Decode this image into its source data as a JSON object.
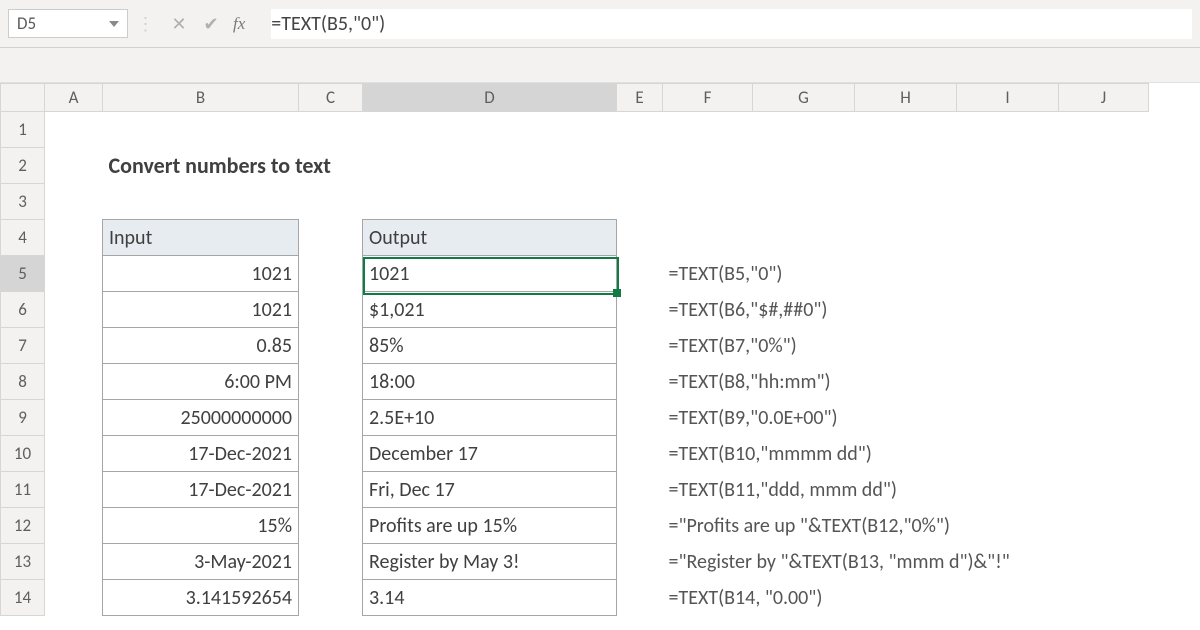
{
  "nameBox": "D5",
  "formula": "=TEXT(B5,\"0\")",
  "columns": [
    "A",
    "B",
    "C",
    "D",
    "E",
    "F",
    "G",
    "H",
    "I",
    "J"
  ],
  "rowNums": [
    "1",
    "2",
    "3",
    "4",
    "5",
    "6",
    "7",
    "8",
    "9",
    "10",
    "11",
    "12",
    "13",
    "14"
  ],
  "title": "Convert numbers to text",
  "headers": {
    "input": "Input",
    "output": "Output"
  },
  "rows": [
    {
      "input": "1021",
      "output": "1021",
      "formula": "=TEXT(B5,\"0\")"
    },
    {
      "input": "1021",
      "output": "$1,021",
      "formula": "=TEXT(B6,\"$#,##0\")"
    },
    {
      "input": "0.85",
      "output": "85%",
      "formula": "=TEXT(B7,\"0%\")"
    },
    {
      "input": "6:00 PM",
      "output": "18:00",
      "formula": "=TEXT(B8,\"hh:mm\")"
    },
    {
      "input": "25000000000",
      "output": "2.5E+10",
      "formula": "=TEXT(B9,\"0.0E+00\")"
    },
    {
      "input": "17-Dec-2021",
      "output": "December 17",
      "formula": "=TEXT(B10,\"mmmm dd\")"
    },
    {
      "input": "17-Dec-2021",
      "output": "Fri, Dec 17",
      "formula": "=TEXT(B11,\"ddd, mmm dd\")"
    },
    {
      "input": "15%",
      "output": "Profits are up 15%",
      "formula": "=\"Profits are up \"&TEXT(B12,\"0%\")"
    },
    {
      "input": "3-May-2021",
      "output": "Register by May 3!",
      "formula": "=\"Register by \"&TEXT(B13, \"mmm d\")&\"!\""
    },
    {
      "input": "3.141592654",
      "output": "3.14",
      "formula": "=TEXT(B14, \"0.00\")"
    }
  ]
}
